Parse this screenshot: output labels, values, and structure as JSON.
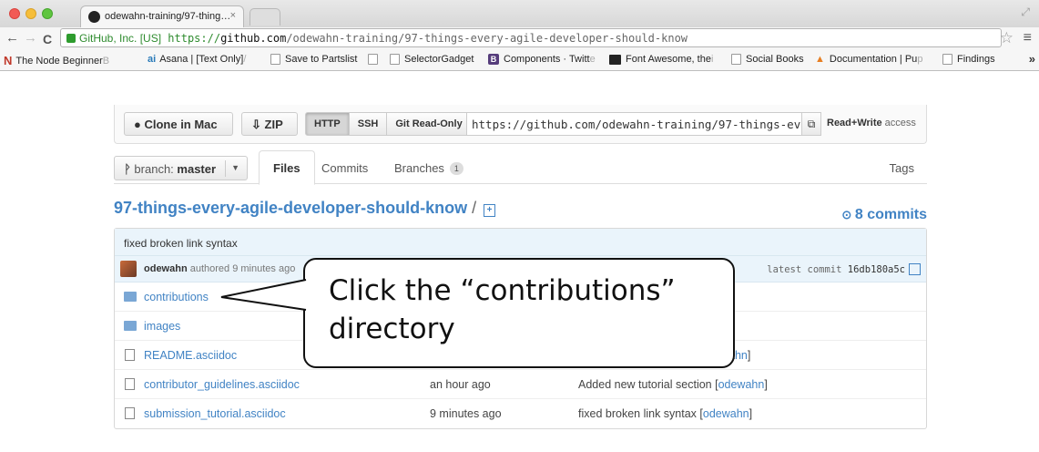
{
  "browser": {
    "tab_title": "odewahn-training/97-thing…",
    "tab_close": "×",
    "url_ev": "GitHub, Inc. [US]",
    "url_https": "https://",
    "url_host": "github.com",
    "url_path": "/odewahn-training/97-things-every-agile-developer-should-know",
    "star": "☆",
    "menu": "≡",
    "back": "←",
    "forward": "→",
    "reload": "C",
    "bookmarks": [
      {
        "label": "The Node Beginner",
        "fade": " B"
      },
      {
        "label": "Asana | [Text Only]",
        "fade": " /"
      },
      {
        "label": "Save to Partslist",
        "fade": ""
      },
      {
        "label": "",
        "fade": ""
      },
      {
        "label": "SelectorGadget",
        "fade": ""
      },
      {
        "label": "Components · Twitt",
        "fade": "e"
      },
      {
        "label": "Font Awesome, the",
        "fade": " i"
      },
      {
        "label": "Social Books",
        "fade": ""
      },
      {
        "label": "Documentation | Pu",
        "fade": "p"
      },
      {
        "label": "Findings",
        "fade": ""
      }
    ],
    "more": "»"
  },
  "clone": {
    "mac_label": "Clone in Mac",
    "zip_label": "ZIP",
    "protocols": [
      "HTTP",
      "SSH",
      "Git Read-Only"
    ],
    "url": "https://github.com/odewahn-training/97-things-every",
    "access_bold": "Read+Write",
    "access_rest": " access"
  },
  "tabs": {
    "branch_prefix": "branch: ",
    "branch": "master",
    "files": "Files",
    "commits": "Commits",
    "branches": "Branches",
    "branches_count": "1",
    "tags": "Tags"
  },
  "repo": {
    "name": "97-things-every-agile-developer-should-know",
    "slash": " / ",
    "commit_count": "8 commits"
  },
  "latest": {
    "message": "fixed broken link syntax",
    "author": "odewahn",
    "authored": " authored 9 minutes ago",
    "label": "latest commit ",
    "sha": "16db180a5c"
  },
  "files": [
    {
      "name": "contributions",
      "type": "dir",
      "age": "",
      "message": "",
      "author": ""
    },
    {
      "name": "images",
      "type": "dir",
      "age": "",
      "message": "",
      "author": ""
    },
    {
      "name": "README.asciidoc",
      "type": "file",
      "age": "",
      "message": "",
      "author": "ahn"
    },
    {
      "name": "contributor_guidelines.asciidoc",
      "type": "file",
      "age": "an hour ago",
      "message": "Added new tutorial section ",
      "author": "odewahn"
    },
    {
      "name": "submission_tutorial.asciidoc",
      "type": "file",
      "age": "9 minutes ago",
      "message": "fixed broken link syntax ",
      "author": "odewahn"
    }
  ],
  "callout": {
    "line1": "Click the  “contributions”",
    "line2": "directory"
  }
}
